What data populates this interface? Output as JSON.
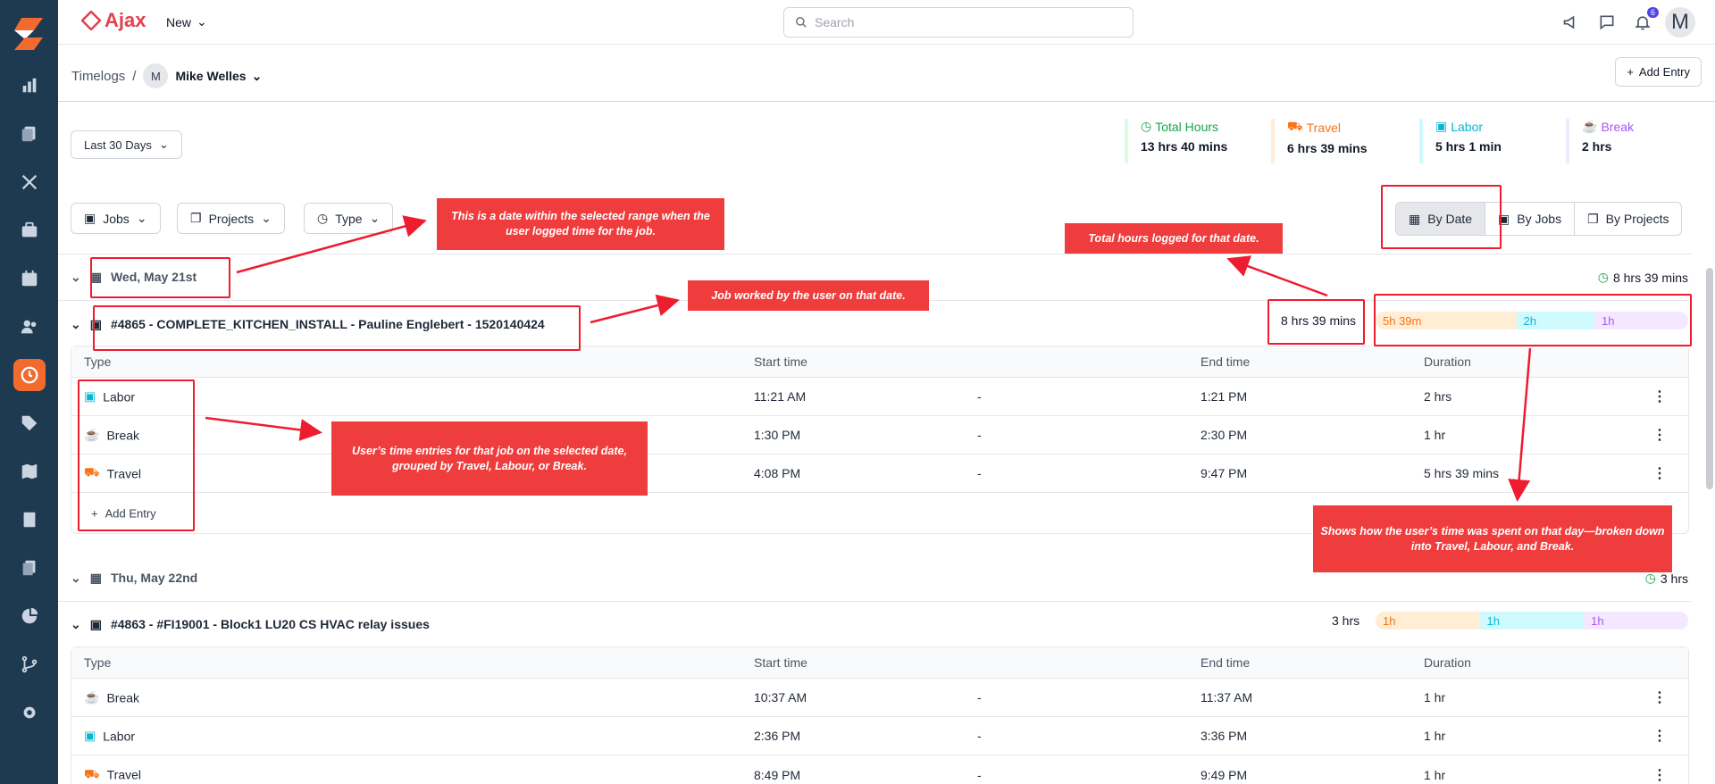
{
  "app": {
    "brand": "Ajax",
    "new_label": "New",
    "search_placeholder": "Search",
    "notif_count": "6",
    "user_initial": "M"
  },
  "breadcrumb": {
    "section": "Timelogs",
    "separator": "/",
    "user_initial": "M",
    "user_name": "Mike Welles"
  },
  "add_entry_label": "Add Entry",
  "range_label": "Last 30 Days",
  "stats": [
    {
      "label": "Total Hours",
      "value": "13 hrs 40 mins",
      "color": "#16a34a",
      "bar": "#dcfce7"
    },
    {
      "label": "Travel",
      "value": "6 hrs 39 mins",
      "color": "#f97316",
      "bar": "#ffedd5"
    },
    {
      "label": "Labor",
      "value": "5 hrs 1 min",
      "color": "#06b6d4",
      "bar": "#cffafe"
    },
    {
      "label": "Break",
      "value": "2 hrs",
      "color": "#a855f7",
      "bar": "#f3e8ff"
    }
  ],
  "filters": {
    "jobs": "Jobs",
    "projects": "Projects",
    "type": "Type"
  },
  "views": {
    "by_date": "By Date",
    "by_jobs": "By Jobs",
    "by_projects": "By Projects"
  },
  "table_headers": {
    "type": "Type",
    "start": "Start time",
    "end": "End time",
    "duration": "Duration"
  },
  "groups": [
    {
      "date": "Wed, May 21st",
      "date_total": "8 hrs 39 mins",
      "job": "#4865 - COMPLETE_KITCHEN_INSTALL - Pauline Englebert - 1520140424",
      "job_total": "8 hrs 39 mins",
      "bar": {
        "travel": "5h 39m",
        "labor": "2h",
        "break": "1h",
        "travel_pct": 45,
        "labor_pct": 25,
        "break_pct": 30
      },
      "rows": [
        {
          "type": "Labor",
          "start": "11:21 AM",
          "dash": "-",
          "end": "1:21 PM",
          "duration": "2 hrs"
        },
        {
          "type": "Break",
          "start": "1:30 PM",
          "dash": "-",
          "end": "2:30 PM",
          "duration": "1 hr"
        },
        {
          "type": "Travel",
          "start": "4:08 PM",
          "dash": "-",
          "end": "9:47 PM",
          "duration": "5 hrs 39 mins"
        }
      ],
      "add_entry": "Add Entry"
    },
    {
      "date": "Thu, May 22nd",
      "date_total": "3 hrs",
      "job": "#4863 - #FI19001 - Block1 LU20 CS HVAC relay issues",
      "job_total": "3 hrs",
      "bar": {
        "travel": "1h",
        "labor": "1h",
        "break": "1h",
        "travel_pct": 33.3,
        "labor_pct": 33.3,
        "break_pct": 33.4
      },
      "rows": [
        {
          "type": "Break",
          "start": "10:37 AM",
          "dash": "-",
          "end": "11:37 AM",
          "duration": "1 hr"
        },
        {
          "type": "Labor",
          "start": "2:36 PM",
          "dash": "-",
          "end": "3:36 PM",
          "duration": "1 hr"
        },
        {
          "type": "Travel",
          "start": "8:49 PM",
          "dash": "-",
          "end": "9:49 PM",
          "duration": "1 hr"
        }
      ]
    }
  ],
  "annotations": {
    "date_note": "This is a date within the selected range when the user logged time for the job.",
    "job_note": "Job worked by the user on that date.",
    "total_note": "Total hours logged for that date.",
    "entries_note": "User’s time entries for that job on the selected date, grouped by Travel, Labour, or Break.",
    "breakdown_note": "Shows how the user’s time was spent on that day—broken down into Travel, Labour, and Break."
  }
}
